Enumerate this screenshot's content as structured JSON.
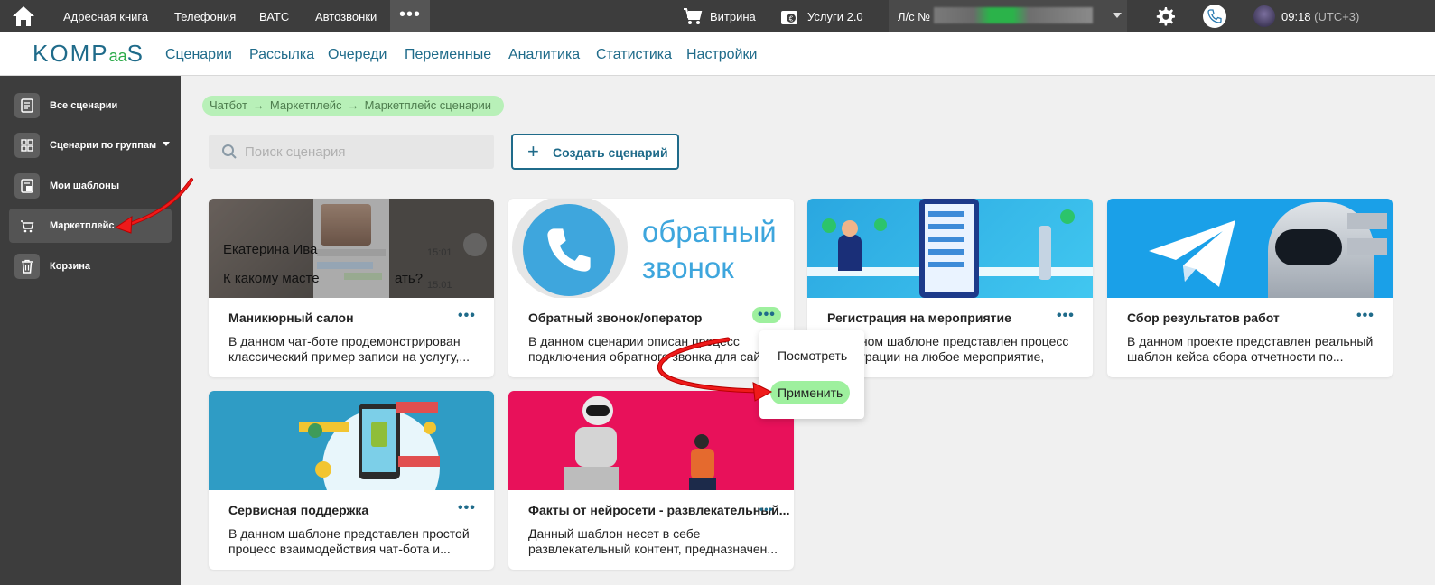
{
  "topbar": {
    "links": [
      "Адресная книга",
      "Телефония",
      "ВАТС",
      "Автозвонки"
    ],
    "more": "•••",
    "vitrina": "Витрина",
    "services": "Услуги 2.0",
    "account_label": "Л/с №",
    "time": "09:18",
    "timezone": "(UTC+3)"
  },
  "navbar": {
    "logo_left": "KOMP",
    "logo_mid": "aa",
    "logo_right": "S",
    "items": [
      "Сценарии",
      "Рассылка",
      "Очереди",
      "Переменные",
      "Аналитика",
      "Статистика",
      "Настройки"
    ]
  },
  "sidebar": {
    "items": [
      {
        "label": "Все сценарии",
        "icon": "list-icon"
      },
      {
        "label": "Сценарии по группам",
        "icon": "grid-icon"
      },
      {
        "label": "Мои шаблоны",
        "icon": "template-icon"
      },
      {
        "label": "Маркетплейс",
        "icon": "cart-icon"
      },
      {
        "label": "Корзина",
        "icon": "trash-icon"
      }
    ]
  },
  "breadcrumb": [
    "Чатбот",
    "Маркетплейс",
    "Маркетплейс сценарии"
  ],
  "breadcrumb_sep": "→",
  "search": {
    "placeholder": "Поиск сценария"
  },
  "create_button": "Создать сценарий",
  "card_dots": "•••",
  "cards": [
    {
      "title": "Маникюрный салон",
      "desc": "В данном чат-боте продемонстрирован классический пример записи на услугу,...",
      "img_text_1": "Екатерина Ива",
      "img_text_2": "К какому масте",
      "img_text_3": "ать?",
      "img_time": "15:01"
    },
    {
      "title": "Обратный звонок/оператор",
      "desc": "В данном сценарии описан процесс подключения обратного звонка для сай...",
      "img_text_1": "обратный",
      "img_text_2": "звонок"
    },
    {
      "title": "Регистрация на мероприятие",
      "desc": "В данном шаблоне представлен процесс регистрации на любое мероприятие, будь..."
    },
    {
      "title": "Сбор результатов работ",
      "desc": "В данном проекте представлен реальный шаблон кейса сбора отчетности по..."
    },
    {
      "title": "Сервисная поддержка",
      "desc": "В данном шаблоне представлен простой процесс взаимодействия чат-бота и..."
    },
    {
      "title": "Факты от нейросети - развлекательный...",
      "desc": "Данный шаблон несет в себе развлекательный контент, предназначен..."
    }
  ],
  "dropdown": {
    "view": "Посмотреть",
    "apply": "Применить"
  },
  "colors": {
    "topbar": "#3d3d3d",
    "accent": "#1f6b8a",
    "highlight": "#9ef09e",
    "annotation": "#e01010"
  }
}
